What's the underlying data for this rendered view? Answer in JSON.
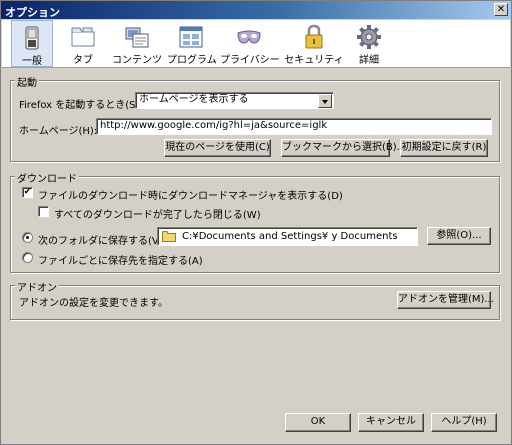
{
  "window": {
    "title": "オプション",
    "close_glyph": "✕"
  },
  "toolbar": {
    "items": [
      {
        "label": "一般",
        "icon": "switch-icon"
      },
      {
        "label": "タブ",
        "icon": "tab-folder-icon"
      },
      {
        "label": "コンテンツ",
        "icon": "content-icon"
      },
      {
        "label": "プログラム",
        "icon": "applications-icon"
      },
      {
        "label": "プライバシー",
        "icon": "privacy-mask-icon"
      },
      {
        "label": "セキュリティ",
        "icon": "lock-icon"
      },
      {
        "label": "詳細",
        "icon": "gear-icon"
      }
    ],
    "selected": 0
  },
  "startup": {
    "title": "起動",
    "when_label": "Firefox を起動するとき(S):",
    "when_value": "ホームページを表示する",
    "homepage_label": "ホームページ(H):",
    "homepage_value": "http://www.google.com/ig?hl=ja&source=iglk",
    "btn_current": "現在のページを使用(C)",
    "btn_bookmark": "ブックマークから選択(B)...",
    "btn_default": "初期設定に戻す(R)"
  },
  "download": {
    "title": "ダウンロード",
    "show_manager": "ファイルのダウンロード時にダウンロードマネージャを表示する(D)",
    "show_manager_checked": true,
    "close_when_done": "すべてのダウンロードが完了したら閉じる(W)",
    "close_when_done_checked": false,
    "save_to_label": "次のフォルダに保存する(V)",
    "save_to_path": "C:¥Documents and Settings¥          y Documents",
    "browse": "参照(O)...",
    "ask_label": "ファイルごとに保存先を指定する(A)",
    "selected": "save_to"
  },
  "addons": {
    "title": "アドオン",
    "desc": "アドオンの設定を変更できます。",
    "btn_manage": "アドオンを管理(M)..."
  },
  "footer": {
    "ok": "OK",
    "cancel": "キャンセル",
    "help": "ヘルプ(H)"
  },
  "colors": {
    "title_start": "#0a246a",
    "title_end": "#a6caf0",
    "face": "#d4d0c8",
    "selected_tab": "#dde6f4"
  }
}
